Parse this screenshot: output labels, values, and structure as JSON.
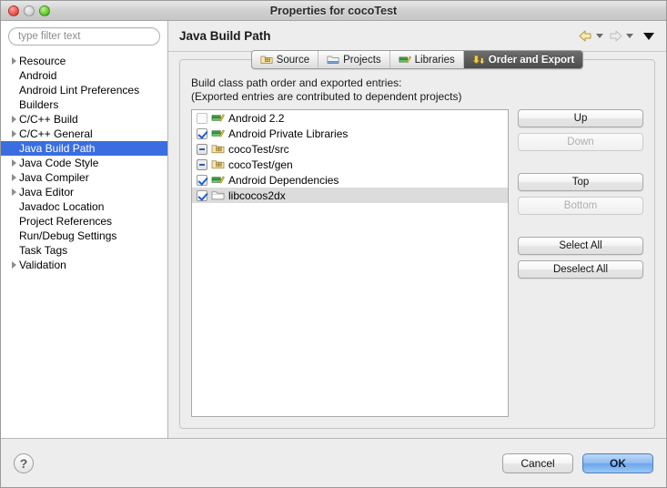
{
  "window": {
    "title": "Properties for cocoTest",
    "controls": [
      {
        "name": "close-button",
        "color": "#e8483f"
      },
      {
        "name": "minimize-button",
        "color": "#cfcfcf"
      },
      {
        "name": "zoom-button",
        "color": "#58c322"
      }
    ]
  },
  "sidebar": {
    "filter": {
      "value": "",
      "placeholder": "type filter text"
    },
    "items": [
      {
        "label": "Resource",
        "expandable": true,
        "selected": false
      },
      {
        "label": "Android",
        "expandable": false,
        "selected": false
      },
      {
        "label": "Android Lint Preferences",
        "expandable": false,
        "selected": false
      },
      {
        "label": "Builders",
        "expandable": false,
        "selected": false
      },
      {
        "label": "C/C++ Build",
        "expandable": true,
        "selected": false
      },
      {
        "label": "C/C++ General",
        "expandable": true,
        "selected": false
      },
      {
        "label": "Java Build Path",
        "expandable": false,
        "selected": true
      },
      {
        "label": "Java Code Style",
        "expandable": true,
        "selected": false
      },
      {
        "label": "Java Compiler",
        "expandable": true,
        "selected": false
      },
      {
        "label": "Java Editor",
        "expandable": true,
        "selected": false
      },
      {
        "label": "Javadoc Location",
        "expandable": false,
        "selected": false
      },
      {
        "label": "Project References",
        "expandable": false,
        "selected": false
      },
      {
        "label": "Run/Debug Settings",
        "expandable": false,
        "selected": false
      },
      {
        "label": "Task Tags",
        "expandable": false,
        "selected": false
      },
      {
        "label": "Validation",
        "expandable": true,
        "selected": false
      }
    ],
    "selection_color": "#3a6ee0"
  },
  "page": {
    "title": "Java Build Path",
    "nav": {
      "back_icon": "back-arrow-icon",
      "back_enabled": true,
      "forward_icon": "forward-arrow-icon",
      "forward_enabled": false,
      "menu_icon": "chevron-down-icon"
    }
  },
  "tabs": [
    {
      "label": "Source",
      "icon": "source-folder-icon",
      "active": false
    },
    {
      "label": "Projects",
      "icon": "projects-folder-icon",
      "active": false
    },
    {
      "label": "Libraries",
      "icon": "libraries-books-icon",
      "active": false
    },
    {
      "label": "Order and Export",
      "icon": "order-export-icon",
      "active": true
    }
  ],
  "panel": {
    "description_line1": "Build class path order and exported entries:",
    "description_line2": "(Exported entries are contributed to dependent projects)",
    "entries": [
      {
        "label": "Android 2.2",
        "check": "unchecked",
        "icon": "library-books-icon",
        "selected": false
      },
      {
        "label": "Android Private Libraries",
        "check": "checked",
        "icon": "library-books-icon",
        "selected": false
      },
      {
        "label": "cocoTest/src",
        "check": "partial",
        "icon": "source-folder-icon",
        "selected": false
      },
      {
        "label": "cocoTest/gen",
        "check": "partial",
        "icon": "source-folder-icon",
        "selected": false
      },
      {
        "label": "Android Dependencies",
        "check": "checked",
        "icon": "library-books-icon",
        "selected": false
      },
      {
        "label": "libcocos2dx",
        "check": "checked",
        "icon": "plain-folder-icon",
        "selected": true
      }
    ],
    "buttons": [
      {
        "label": "Up",
        "enabled": true
      },
      {
        "label": "Down",
        "enabled": false
      },
      {
        "label": "Top",
        "enabled": true
      },
      {
        "label": "Bottom",
        "enabled": false
      },
      {
        "label": "Select All",
        "enabled": true
      },
      {
        "label": "Deselect All",
        "enabled": true
      }
    ]
  },
  "footer": {
    "help_label": "?",
    "cancel_label": "Cancel",
    "ok_label": "OK",
    "default_button_color": "#6ba6ea"
  }
}
